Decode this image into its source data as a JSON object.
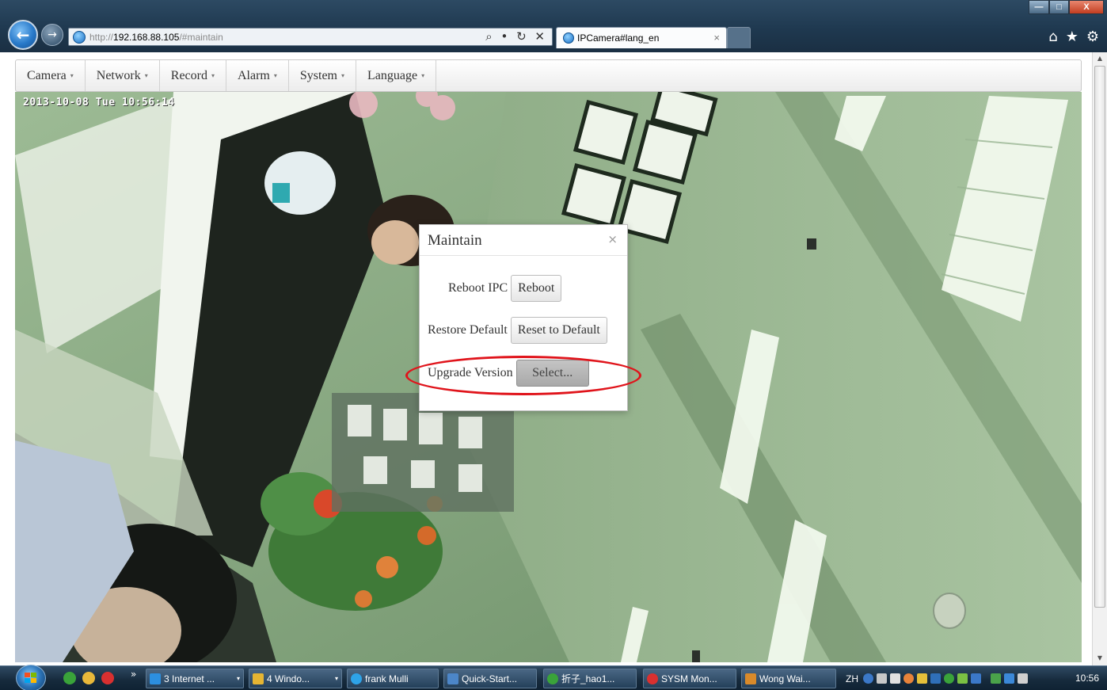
{
  "browser": {
    "address": {
      "url_prefix": "http://",
      "url_host": "192.168.88.105",
      "url_hash": "/#maintain",
      "controls": "⌕ • ↻ ✕"
    },
    "tab_title": "IPCamera#lang_en",
    "tab_close": "×",
    "window_controls": {
      "minimize": "—",
      "maximize": "□",
      "close": "X"
    },
    "icons": [
      "home-icon",
      "favorites-star-icon",
      "tools-gear-icon"
    ]
  },
  "menu": {
    "items": [
      {
        "label": "Camera"
      },
      {
        "label": "Network"
      },
      {
        "label": "Record"
      },
      {
        "label": "Alarm"
      },
      {
        "label": "System"
      },
      {
        "label": "Language"
      }
    ],
    "caret": "▾"
  },
  "feed": {
    "osd_timestamp": "2013-10-08 Tue 10:56:14"
  },
  "modal": {
    "title": "Maintain",
    "close": "×",
    "rows": [
      {
        "label": "Reboot IPC",
        "button": "Reboot"
      },
      {
        "label": "Restore Default",
        "button": "Reset to Default"
      },
      {
        "label": "Upgrade Version",
        "button": "Select..."
      }
    ],
    "highlight_color": "#e0141b"
  },
  "taskbar": {
    "overflow": "»",
    "buttons": [
      {
        "label": "3 Internet ...",
        "icon": "ie-icon",
        "color": "#2c8fe0"
      },
      {
        "label": "4 Windo...",
        "icon": "folder-icon",
        "color": "#e6b533"
      },
      {
        "label": "frank Mulli",
        "icon": "chat-icon",
        "color": "#2ea3e8"
      },
      {
        "label": "Quick-Start...",
        "icon": "document-icon",
        "color": "#4c86c8"
      },
      {
        "label": "折子_hao1...",
        "icon": "app-icon",
        "color": "#3aa33a"
      },
      {
        "label": "SYSM Mon...",
        "icon": "monitor-icon",
        "color": "#d93030"
      },
      {
        "label": "Wong Wai...",
        "icon": "user-icon",
        "color": "#d98a2a"
      }
    ],
    "tray": {
      "lang": "ZH",
      "clock": "10:56"
    }
  }
}
